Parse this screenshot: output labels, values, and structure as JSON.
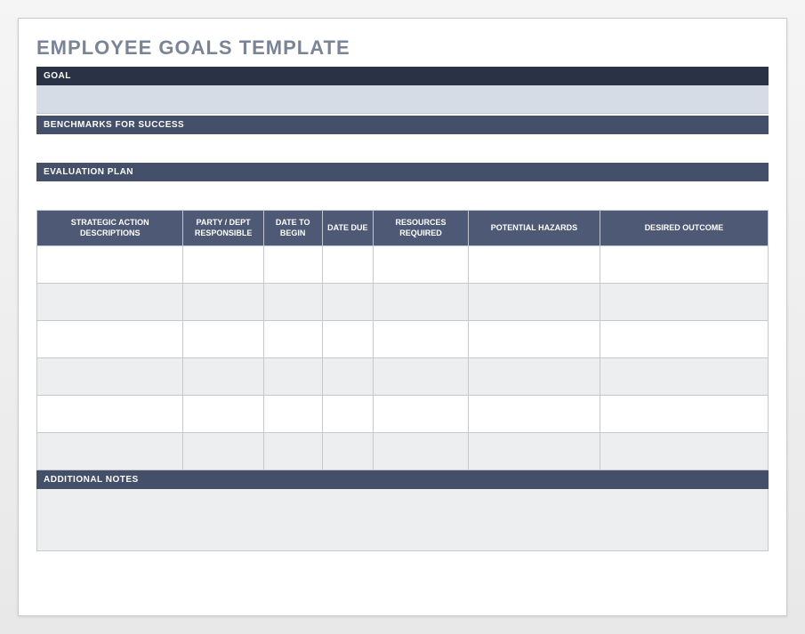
{
  "title": "EMPLOYEE GOALS TEMPLATE",
  "sections": {
    "goal": "GOAL",
    "benchmarks": "BENCHMARKS FOR SUCCESS",
    "evaluation": "EVALUATION PLAN",
    "notes": "ADDITIONAL NOTES"
  },
  "table": {
    "headers": [
      "STRATEGIC ACTION DESCRIPTIONS",
      "PARTY / DEPT RESPONSIBLE",
      "DATE TO BEGIN",
      "DATE DUE",
      "RESOURCES REQUIRED",
      "POTENTIAL HAZARDS",
      "DESIRED OUTCOME"
    ],
    "rows": [
      [
        "",
        "",
        "",
        "",
        "",
        "",
        ""
      ],
      [
        "",
        "",
        "",
        "",
        "",
        "",
        ""
      ],
      [
        "",
        "",
        "",
        "",
        "",
        "",
        ""
      ],
      [
        "",
        "",
        "",
        "",
        "",
        "",
        ""
      ],
      [
        "",
        "",
        "",
        "",
        "",
        "",
        ""
      ],
      [
        "",
        "",
        "",
        "",
        "",
        "",
        ""
      ]
    ]
  },
  "values": {
    "goal": "",
    "benchmarks": "",
    "evaluation": "",
    "notes": ""
  }
}
